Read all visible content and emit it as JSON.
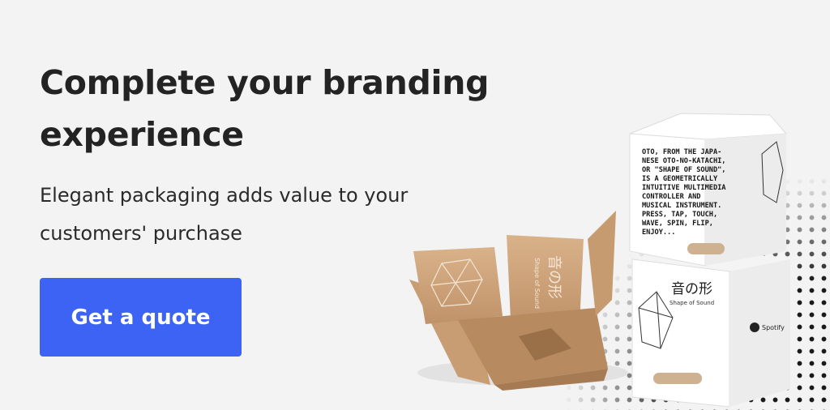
{
  "banner": {
    "headline": "Complete your branding experience",
    "subline": "Elegant packaging adds value to your customers' purchase",
    "cta_label": "Get a quote",
    "accent_color": "#3c63f3"
  },
  "product": {
    "hex_box_text": [
      "OTO, FROM THE JAPA-",
      "NESE OTO-NO-KATACHI,",
      "OR \"SHAPE OF SOUND\",",
      "IS A GEOMETRICALLY",
      "INTUITIVE MULTIMEDIA",
      "CONTROLLER AND",
      "MUSICAL INSTRUMENT.",
      "PRESS, TAP, TOUCH,",
      "WAVE, SPIN, FLIP,",
      "ENJOY..."
    ],
    "japanese_title": "音の形",
    "english_title": "Shape of Sound",
    "brand": "Spotify"
  }
}
